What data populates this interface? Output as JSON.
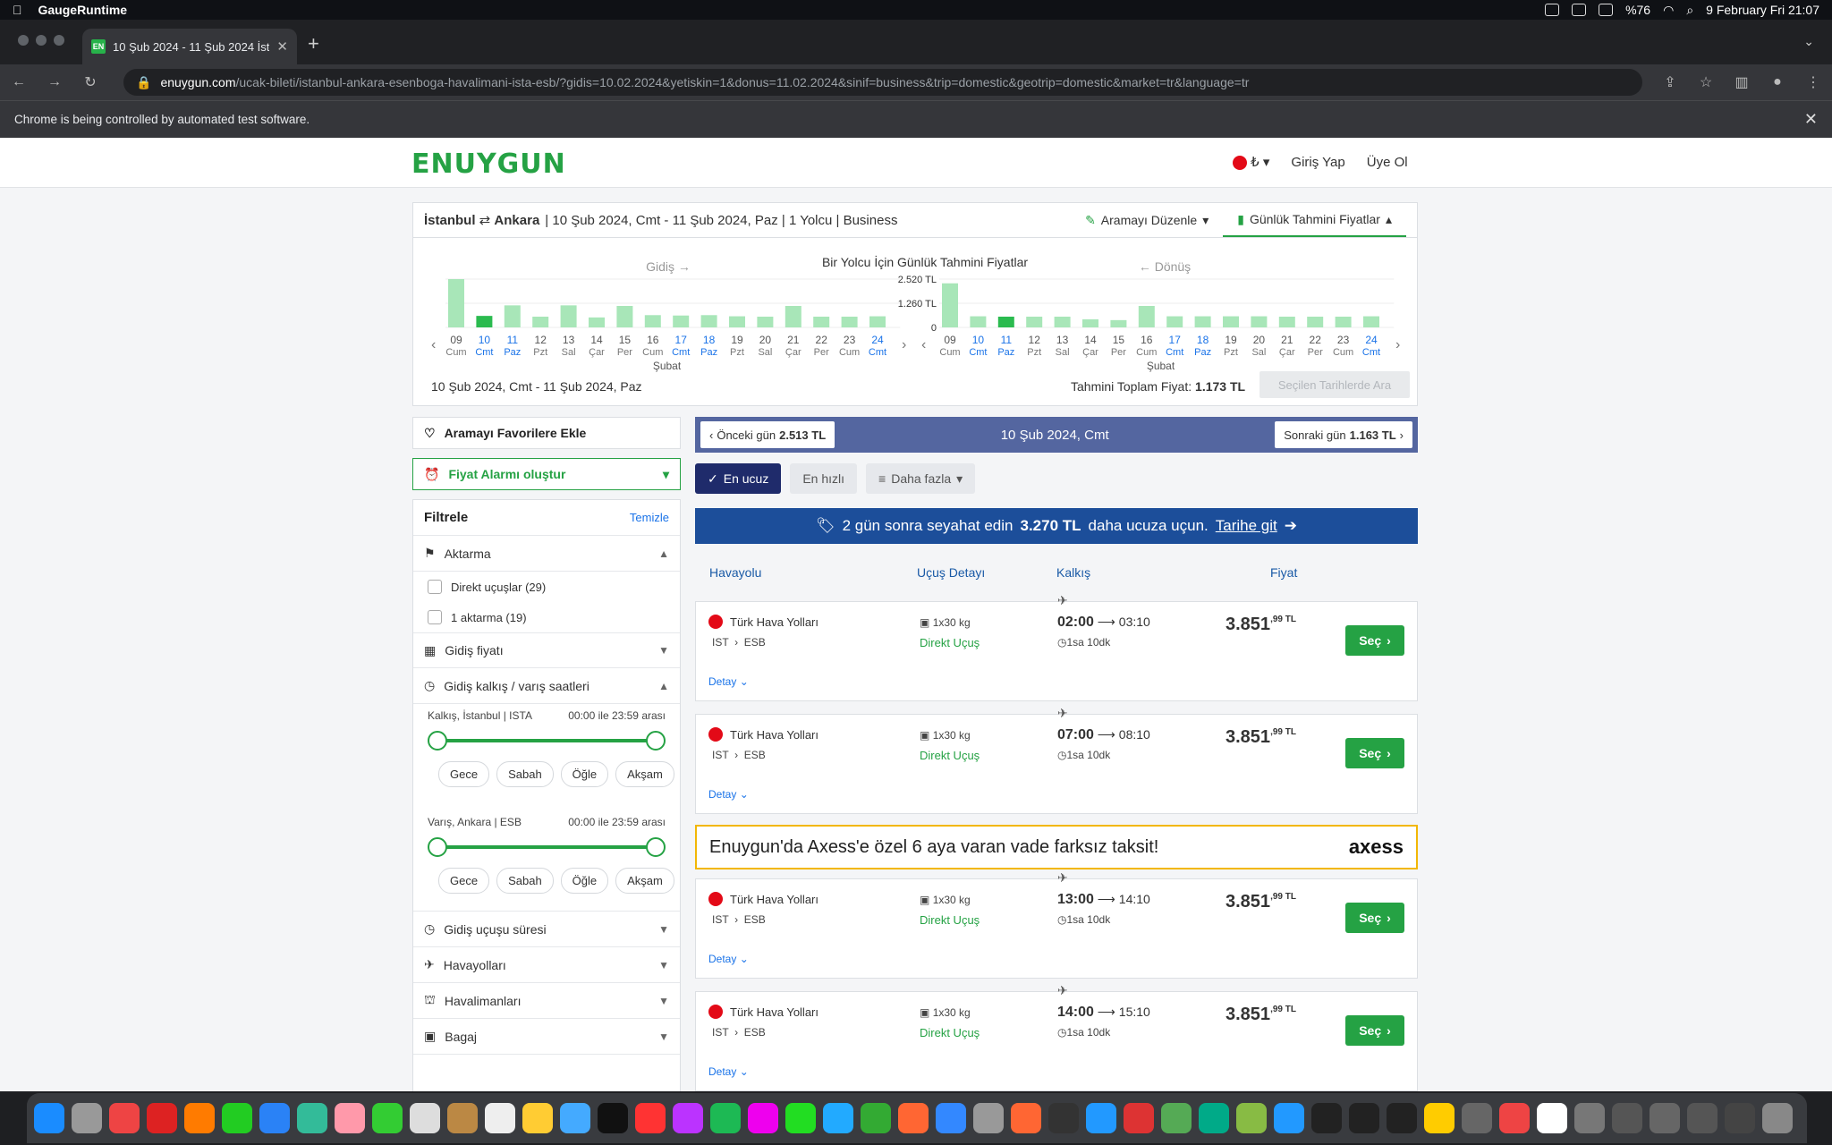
{
  "menubar": {
    "app": "GaugeRuntime",
    "battery": "%76",
    "datetime": "9 February Fri  21:07"
  },
  "browser": {
    "tab_title": "10 Şub 2024 - 11 Şub 2024 İst",
    "tab_favicon": "EN",
    "url_domain": "enuygun.com",
    "url_path": "/ucak-bileti/istanbul-ankara-esenboga-havalimani-ista-esb/?gidis=10.02.2024&yetiskin=1&donus=11.02.2024&sinif=business&trip=domestic&geotrip=domestic&market=tr&language=tr",
    "infobar": "Chrome is being controlled by automated test software."
  },
  "header": {
    "logo": "ENUYGUN",
    "currency": "₺",
    "login": "Giriş Yap",
    "signup": "Üye Ol"
  },
  "summary": {
    "from": "İstanbul",
    "to": "Ankara",
    "details": "| 10 Şub 2024, Cmt - 11 Şub 2024, Paz | 1 Yolcu | Business",
    "edit": "Aramayı Düzenle",
    "daily": "Günlük Tahmini Fiyatlar"
  },
  "chart_data": {
    "type": "bar",
    "title": "Bir Yolcu İçin Günlük Tahmini Fiyatlar",
    "y_ticks": [
      "2.520 TL",
      "1.260 TL",
      "0"
    ],
    "month": "Şubat",
    "departure": {
      "label": "Gidiş",
      "categories": [
        "09",
        "10",
        "11",
        "12",
        "13",
        "14",
        "15",
        "16",
        "17",
        "18",
        "19",
        "20",
        "21",
        "22",
        "23",
        "24"
      ],
      "weekdays": [
        "Cum",
        "Cmt",
        "Paz",
        "Pzt",
        "Sal",
        "Çar",
        "Per",
        "Cum",
        "Cmt",
        "Paz",
        "Pzt",
        "Sal",
        "Çar",
        "Per",
        "Cum",
        "Cmt"
      ],
      "values": [
        2520,
        600,
        1150,
        560,
        1150,
        520,
        1120,
        640,
        620,
        640,
        580,
        560,
        1120,
        560,
        560,
        580
      ],
      "selected": "10"
    },
    "return": {
      "label": "Dönüş",
      "categories": [
        "09",
        "10",
        "11",
        "12",
        "13",
        "14",
        "15",
        "16",
        "17",
        "18",
        "19",
        "20",
        "21",
        "22",
        "23",
        "24"
      ],
      "weekdays": [
        "Cum",
        "Cmt",
        "Paz",
        "Pzt",
        "Sal",
        "Çar",
        "Per",
        "Cum",
        "Cmt",
        "Paz",
        "Pzt",
        "Sal",
        "Çar",
        "Per",
        "Cum",
        "Cmt"
      ],
      "values": [
        2300,
        580,
        560,
        560,
        560,
        420,
        380,
        1120,
        580,
        580,
        580,
        580,
        560,
        560,
        560,
        580
      ],
      "selected": "11"
    }
  },
  "chart_footer": {
    "dates": "10 Şub 2024, Cmt - 11 Şub 2024, Paz",
    "total_label": "Tahmini Toplam Fiyat:",
    "total_value": "1.173 TL",
    "search_btn": "Seçilen Tarihlerde Ara"
  },
  "left": {
    "fav": "Aramayı Favorilere Ekle",
    "alarm": "Fiyat Alarmı oluştur",
    "filter_title": "Filtrele",
    "clear": "Temizle",
    "transfer": "Aktarma",
    "direct": "Direkt uçuşlar (29)",
    "one_stop": "1 aktarma (19)",
    "dep_price": "Gidiş fiyatı",
    "dep_times": "Gidiş kalkış / varış saatleri",
    "dep_label": "Kalkış, İstanbul | ISTA",
    "arr_label": "Varış, Ankara | ESB",
    "range": "00:00 ile 23:59 arası",
    "slots": [
      "Gece",
      "Sabah",
      "Öğle",
      "Akşam"
    ],
    "duration": "Gidiş uçuşu süresi",
    "airlines": "Havayolları",
    "airports": "Havalimanları",
    "baggage": "Bagaj"
  },
  "daynav": {
    "prev_label": "Önceki gün",
    "prev_price": "2.513 TL",
    "current": "10 Şub 2024, Cmt",
    "next_label": "Sonraki gün",
    "next_price": "1.163 TL"
  },
  "sort": {
    "cheapest": "En ucuz",
    "fastest": "En hızlı",
    "more": "Daha fazla"
  },
  "promo": {
    "pre": "2 gün sonra seyahat edin",
    "amount": "3.270 TL",
    "post": "daha ucuza uçun.",
    "link": "Tarihe git"
  },
  "columns": {
    "airline": "Havayolu",
    "detail": "Uçuş Detayı",
    "departure": "Kalkış",
    "price": "Fiyat"
  },
  "flights": [
    {
      "airline": "Türk Hava Yolları",
      "from": "IST",
      "to": "ESB",
      "bag": "1x30 kg",
      "type": "Direkt Uçuş",
      "dep": "02:00",
      "arr": "03:10",
      "dur": "1sa 10dk",
      "price": "3.851",
      "cents": ",99 TL",
      "select": "Seç",
      "detail": "Detay"
    },
    {
      "airline": "Türk Hava Yolları",
      "from": "IST",
      "to": "ESB",
      "bag": "1x30 kg",
      "type": "Direkt Uçuş",
      "dep": "07:00",
      "arr": "08:10",
      "dur": "1sa 10dk",
      "price": "3.851",
      "cents": ",99 TL",
      "select": "Seç",
      "detail": "Detay"
    },
    {
      "airline": "Türk Hava Yolları",
      "from": "IST",
      "to": "ESB",
      "bag": "1x30 kg",
      "type": "Direkt Uçuş",
      "dep": "13:00",
      "arr": "14:10",
      "dur": "1sa 10dk",
      "price": "3.851",
      "cents": ",99 TL",
      "select": "Seç",
      "detail": "Detay"
    },
    {
      "airline": "Türk Hava Yolları",
      "from": "IST",
      "to": "ESB",
      "bag": "1x30 kg",
      "type": "Direkt Uçuş",
      "dep": "14:00",
      "arr": "15:10",
      "dur": "1sa 10dk",
      "price": "3.851",
      "cents": ",99 TL",
      "select": "Seç",
      "detail": "Detay"
    }
  ],
  "axess": {
    "text": "Enuygun'da Axess'e özel 6 aya varan vade farksız taksit!",
    "logo": "axess"
  },
  "dock": {
    "calendar_day": "9"
  }
}
